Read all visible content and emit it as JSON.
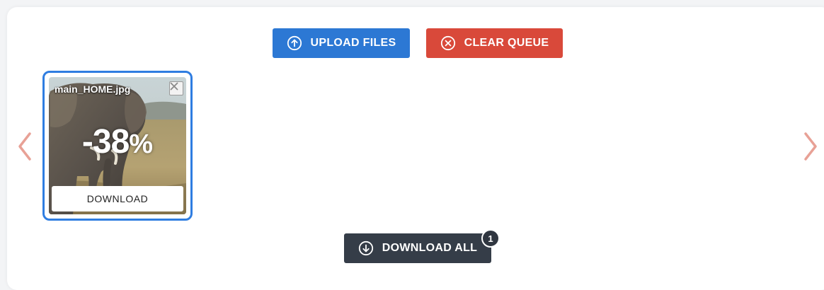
{
  "toolbar": {
    "upload_label": "UPLOAD FILES",
    "clear_label": "CLEAR QUEUE",
    "upload_icon": "arrow-up-circle-icon",
    "clear_icon": "x-circle-icon"
  },
  "carousel": {
    "prev_icon": "chevron-left-icon",
    "next_icon": "chevron-right-icon",
    "arrow_color": "#e8a196"
  },
  "queue": {
    "items": [
      {
        "filename": "main_HOME.jpg",
        "reduction_value": "-38",
        "reduction_unit": "%",
        "download_label": "DOWNLOAD",
        "thumbnail": "elephant-photo"
      }
    ]
  },
  "footer": {
    "download_all_label": "DOWNLOAD ALL",
    "download_all_icon": "arrow-down-circle-icon",
    "count_badge": "1"
  },
  "colors": {
    "upload": "#2c78d4",
    "clear": "#d9493a",
    "download_all": "#353d48",
    "card_border": "#2f7de1"
  }
}
